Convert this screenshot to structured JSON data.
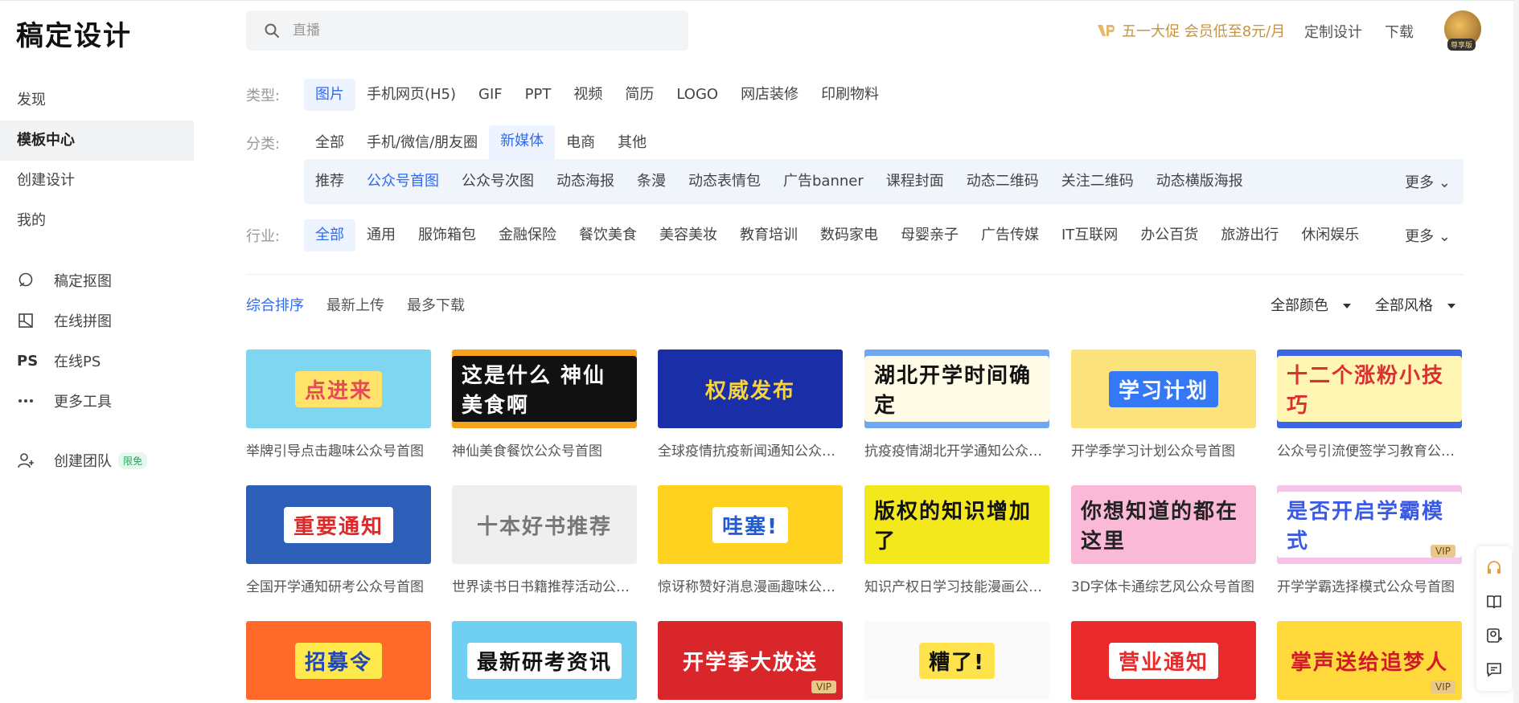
{
  "header": {
    "logo": "稿定设计",
    "search_placeholder": "直播",
    "promo": "五一大促 会员低至8元/月",
    "custom_design": "定制设计",
    "download": "下载",
    "avatar_tag": "尊享版"
  },
  "sidebar": {
    "items": [
      {
        "label": "发现"
      },
      {
        "label": "模板中心"
      },
      {
        "label": "创建设计"
      },
      {
        "label": "我的"
      }
    ],
    "tools": [
      {
        "label": "稿定抠图",
        "icon": "cutout-icon"
      },
      {
        "label": "在线拼图",
        "icon": "collage-icon"
      },
      {
        "label": "在线PS",
        "icon": "ps-icon"
      },
      {
        "label": "更多工具",
        "icon": "more-dots-icon"
      }
    ],
    "team": {
      "label": "创建团队",
      "badge": "限免"
    }
  },
  "filters": {
    "type_label": "类型:",
    "types": [
      "图片",
      "手机网页(H5)",
      "GIF",
      "PPT",
      "视频",
      "简历",
      "LOGO",
      "网店装修",
      "印刷物料"
    ],
    "category_label": "分类:",
    "categories": [
      "全部",
      "手机/微信/朋友圈",
      "新媒体",
      "电商",
      "其他"
    ],
    "sub_categories": [
      "推荐",
      "公众号首图",
      "公众号次图",
      "动态海报",
      "条漫",
      "动态表情包",
      "广告banner",
      "课程封面",
      "动态二维码",
      "关注二维码",
      "动态横版海报"
    ],
    "industry_label": "行业:",
    "industries": [
      "全部",
      "通用",
      "服饰箱包",
      "金融保险",
      "餐饮美食",
      "美容美妆",
      "教育培训",
      "数码家电",
      "母婴亲子",
      "广告传媒",
      "IT互联网",
      "办公百货",
      "旅游出行",
      "休闲娱乐"
    ],
    "more": "更多"
  },
  "sort": {
    "options": [
      "综合排序",
      "最新上传",
      "最多下载"
    ],
    "color_filter": "全部颜色",
    "style_filter": "全部风格"
  },
  "templates": [
    {
      "title": "举牌引导点击趣味公众号首图",
      "thumb_text": "点进来",
      "bg": "#7fd6f0",
      "fg": "#e8485a",
      "box": "#ffe36a"
    },
    {
      "title": "神仙美食餐饮公众号首图",
      "thumb_text": "这是什么 神仙美食啊",
      "bg": "#f7a21b",
      "fg": "#ffffff",
      "box": "#111111"
    },
    {
      "title": "全球疫情抗疫新闻通知公众号首图",
      "thumb_text": "权威发布",
      "bg": "#1a2ea8",
      "fg": "#f5d341",
      "box": "transparent"
    },
    {
      "title": "抗疫疫情湖北开学通知公众号首图",
      "thumb_text": "湖北开学时间确定",
      "bg": "#6fa7f2",
      "fg": "#111111",
      "box": "#fffbe6"
    },
    {
      "title": "开学季学习计划公众号首图",
      "thumb_text": "学习计划",
      "bg": "#fbe27a",
      "fg": "#ffffff",
      "box": "#3478f5"
    },
    {
      "title": "公众号引流便签学习教育公众号首图",
      "thumb_text": "十二个涨粉小技巧",
      "bg": "#3e66e3",
      "fg": "#d93030",
      "box": "#fff6b3"
    },
    {
      "title": "全国开学通知研考公众号首图",
      "thumb_text": "重要通知",
      "bg": "#2e5fb8",
      "fg": "#d92b2b",
      "box": "#ffffff"
    },
    {
      "title": "世界读书日书籍推荐活动公众号首图",
      "thumb_text": "十本好书推荐",
      "bg": "#efefef",
      "fg": "#777777",
      "box": "transparent"
    },
    {
      "title": "惊讶称赞好消息漫画趣味公众号首图",
      "thumb_text": "哇塞!",
      "bg": "#ffd21f",
      "fg": "#1f5bd4",
      "box": "#ffffff"
    },
    {
      "title": "知识产权日学习技能漫画公众号首图",
      "thumb_text": "版权的知识增加了",
      "bg": "#f3e81b",
      "fg": "#111111",
      "box": "transparent"
    },
    {
      "title": "3D字体卡通综艺风公众号首图",
      "thumb_text": "你想知道的都在这里",
      "bg": "#f9b9d7",
      "fg": "#222222",
      "box": "transparent"
    },
    {
      "title": "开学学霸选择模式公众号首图",
      "thumb_text": "是否开启学霸模式",
      "bg": "#f5c4e8",
      "fg": "#3a5ae6",
      "box": "#ffffff",
      "vip": "VIP"
    },
    {
      "title": "",
      "thumb_text": "招募令",
      "bg": "#ff6a2b",
      "fg": "#2148b8",
      "box": "#ffe94d"
    },
    {
      "title": "",
      "thumb_text": "最新研考资讯",
      "bg": "#6fd0f2",
      "fg": "#111111",
      "box": "#ffffff"
    },
    {
      "title": "",
      "thumb_text": "开学季大放送",
      "bg": "#d9262a",
      "fg": "#ffffff",
      "box": "transparent",
      "vip": "VIP"
    },
    {
      "title": "",
      "thumb_text": "糟了!",
      "bg": "#fafafa",
      "fg": "#111111",
      "box": "#ffe34d"
    },
    {
      "title": "",
      "thumb_text": "营业通知",
      "bg": "#e82a2a",
      "fg": "#e82a2a",
      "box": "#ffffff"
    },
    {
      "title": "",
      "thumb_text": "掌声送给追梦人",
      "bg": "#ffd93b",
      "fg": "#d1192b",
      "box": "transparent",
      "vip": "VIP"
    }
  ],
  "floatbar": {
    "icons": [
      "headset-icon",
      "book-icon",
      "add-user-icon",
      "message-icon"
    ]
  }
}
